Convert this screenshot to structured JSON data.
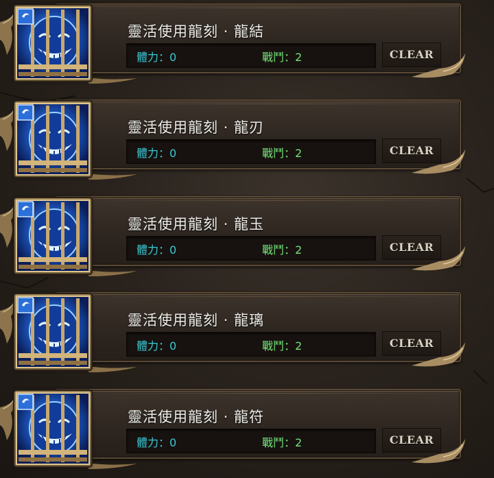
{
  "items": [
    {
      "title": "靈活使用龍刻 · 龍結",
      "hp_label": "體力：0",
      "atk_label": "戰鬥：2",
      "clear_label": "CLEAR",
      "icon": "blue-grinning-mask-caged-icon"
    },
    {
      "title": "靈活使用龍刻 · 龍刃",
      "hp_label": "體力：0",
      "atk_label": "戰鬥：2",
      "clear_label": "CLEAR",
      "icon": "blue-grinning-mask-caged-icon"
    },
    {
      "title": "靈活使用龍刻 · 龍玉",
      "hp_label": "體力：0",
      "atk_label": "戰鬥：2",
      "clear_label": "CLEAR",
      "icon": "blue-grinning-mask-caged-icon"
    },
    {
      "title": "靈活使用龍刻 · 龍璃",
      "hp_label": "體力：0",
      "atk_label": "戰鬥：2",
      "clear_label": "CLEAR",
      "icon": "blue-grinning-mask-caged-icon"
    },
    {
      "title": "靈活使用龍刻 · 龍符",
      "hp_label": "體力：0",
      "atk_label": "戰鬥：2",
      "clear_label": "CLEAR",
      "icon": "blue-grinning-mask-caged-icon"
    }
  ],
  "colors": {
    "hp": "#39c9d6",
    "atk": "#74e27a",
    "title": "#ecece8",
    "clear_text": "#d9d2c4",
    "panel_border": "#5a4935"
  }
}
